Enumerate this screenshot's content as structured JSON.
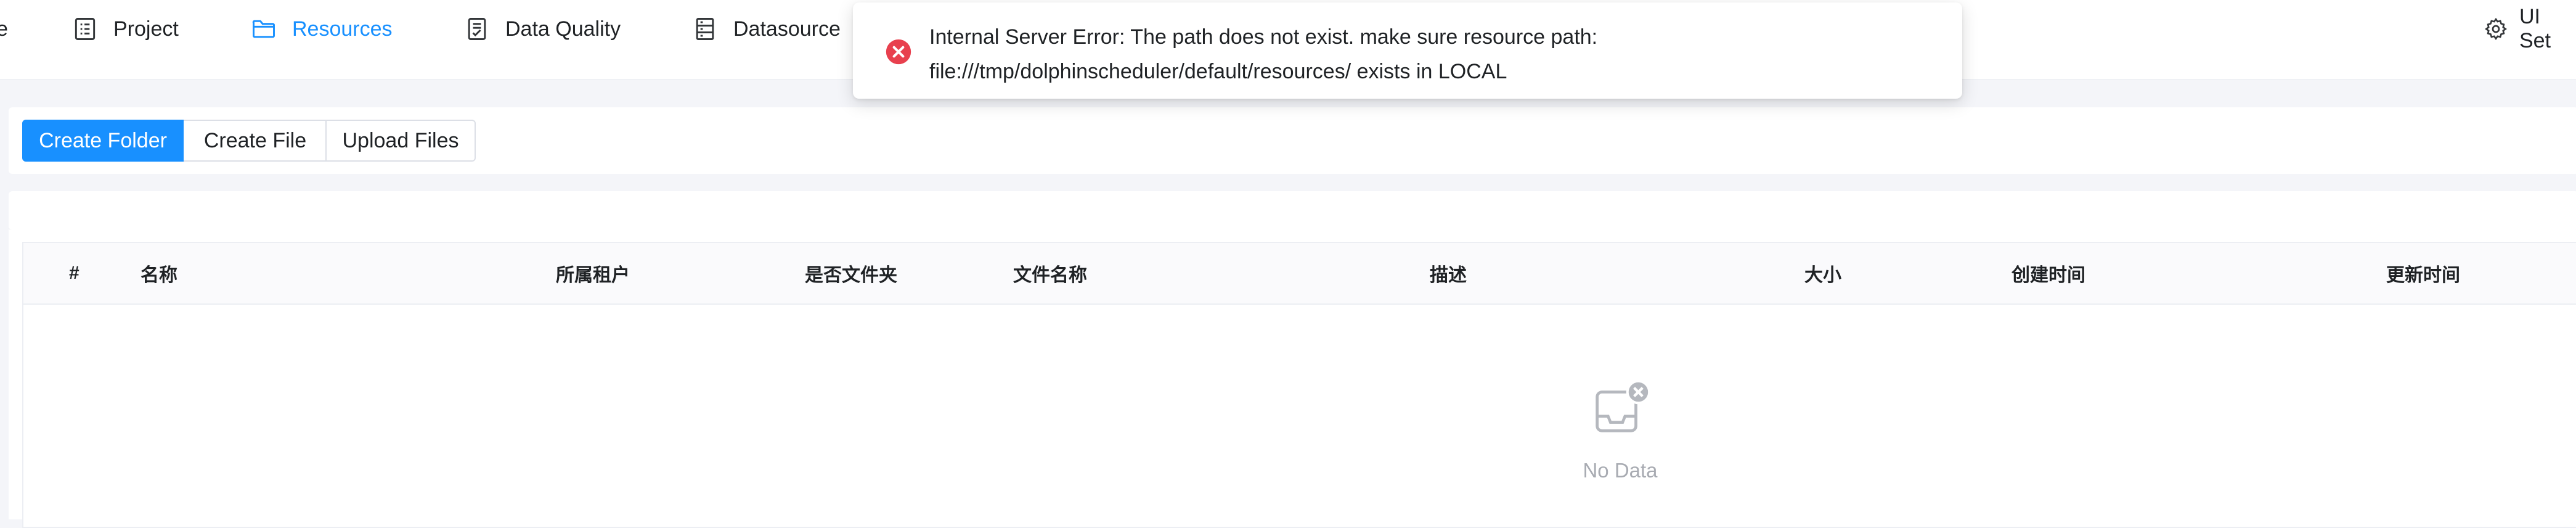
{
  "nav": {
    "partial_left": "e",
    "items": [
      {
        "label": "Project",
        "icon": "list-icon"
      },
      {
        "label": "Resources",
        "icon": "folder-icon"
      },
      {
        "label": "Data Quality",
        "icon": "checklist-icon"
      },
      {
        "label": "Datasource",
        "icon": "server-icon"
      }
    ],
    "settings_label": "UI Set",
    "active": "Resources"
  },
  "toolbar": {
    "create_folder": "Create Folder",
    "create_file": "Create File",
    "upload_files": "Upload Files"
  },
  "table": {
    "columns": [
      "#",
      "名称",
      "所属租户",
      "是否文件夹",
      "文件名称",
      "描述",
      "大小",
      "创建时间",
      "更新时间"
    ],
    "rows": [],
    "empty_text": "No Data"
  },
  "toast": {
    "line1": "Internal Server Error: The path does not exist. make sure resource path:",
    "line2": "file:///tmp/dolphinscheduler/default/resources/ exists in LOCAL"
  },
  "colors": {
    "accent": "#1890ff",
    "error": "#e8404e"
  }
}
